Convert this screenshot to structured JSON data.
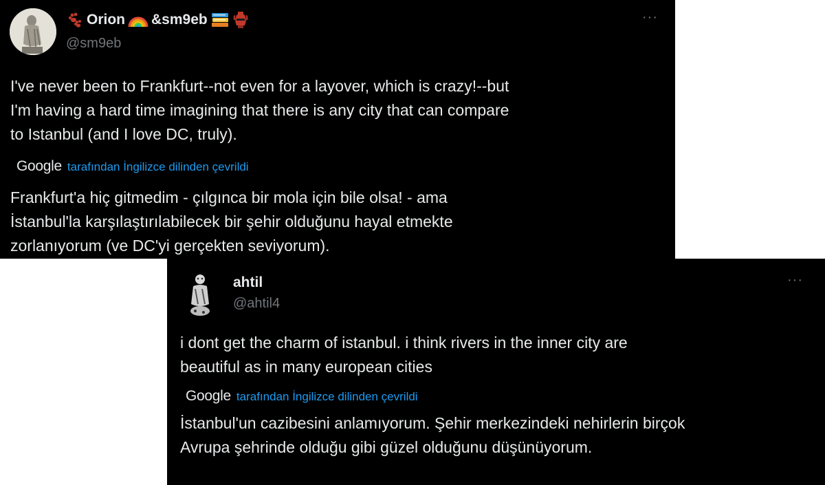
{
  "tweets": [
    {
      "display_name": "Orion",
      "display_name_suffix": "&sm9eb",
      "handle": "@sm9eb",
      "more_label": "···",
      "text": "I've never been to Frankfurt--not even for a layover, which is crazy!--but\nI'm having a hard time imagining that there is any city that can compare\nto Istanbul (and I love DC, truly).",
      "translation_provider": "Google",
      "translation_label": "tarafından İngilizce dilinden çevrildi",
      "translated_text": "Frankfurt'a hiç gitmedim - çılgınca bir mola için bile olsa! - ama\nİstanbul'la karşılaştırılabilecek bir şehir olduğunu hayal etmekte\nzorlanıyorum (ve DC'yi gerçekten seviyorum).",
      "icons": [
        "paw-prints-icon",
        "rainbow-icon",
        "books-icon",
        "amphora-icon"
      ]
    },
    {
      "display_name": "ahtil",
      "handle": "@ahtil4",
      "more_label": "···",
      "text": "i dont get the charm of istanbul. i think rivers in the inner city are\nbeautiful as in many european cities",
      "translation_provider": "Google",
      "translation_label": "tarafından İngilizce dilinden çevrildi",
      "translated_text": "İstanbul'un cazibesini anlamıyorum. Şehir merkezindeki nehirlerin birçok\nAvrupa şehrinde olduğu gibi güzel olduğunu düşünüyorum."
    }
  ],
  "colors": {
    "background": "#000000",
    "text": "#e7e9ea",
    "secondary": "#71767b",
    "link": "#1d9bf0"
  }
}
